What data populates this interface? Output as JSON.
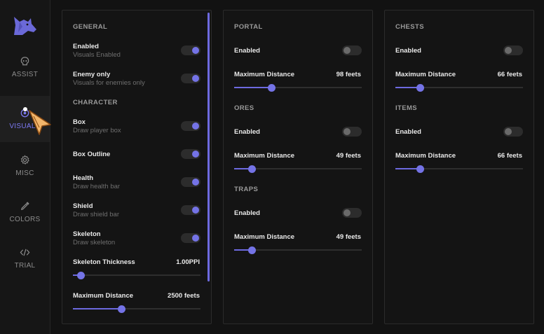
{
  "nav": [
    {
      "label": "",
      "icon": "wolf-logo-icon"
    },
    {
      "label": "ASSIST",
      "icon": "skull-icon"
    },
    {
      "label": "VISUALS",
      "icon": "eye-icon",
      "active": true
    },
    {
      "label": "MISC",
      "icon": "gear-icon"
    },
    {
      "label": "COLORS",
      "icon": "eyedropper-icon"
    },
    {
      "label": "TRIAL",
      "icon": "code-icon"
    }
  ],
  "colors": {
    "accent": "#7473e6",
    "background": "#121212",
    "panel": "#141414"
  },
  "left": {
    "general_title": "GENERAL",
    "character_title": "CHARACTER",
    "enabled": {
      "label": "Enabled",
      "sub": "Visuals Enabled",
      "on": true
    },
    "enemy_only": {
      "label": "Enemy only",
      "sub": "Visuals for enemies only",
      "on": true
    },
    "box": {
      "label": "Box",
      "sub": "Draw player box",
      "on": true
    },
    "box_outline": {
      "label": "Box Outline",
      "on": true
    },
    "health": {
      "label": "Health",
      "sub": "Draw health bar",
      "on": true
    },
    "shield": {
      "label": "Shield",
      "sub": "Draw shield bar",
      "on": true
    },
    "skeleton": {
      "label": "Skeleton",
      "sub": "Draw skeleton",
      "on": true
    },
    "skeleton_thickness": {
      "label": "Skeleton Thickness",
      "value": "1.00PPI",
      "fraction": 0.06
    },
    "max_distance": {
      "label": "Maximum Distance",
      "value": "2500 feets",
      "fraction": 0.38
    }
  },
  "middle": {
    "portal_title": "PORTAL",
    "portal_enabled": {
      "label": "Enabled",
      "on": false
    },
    "portal_distance": {
      "label": "Maximum Distance",
      "value": "98 feets",
      "fraction": 0.29
    },
    "ores_title": "ORES",
    "ores_enabled": {
      "label": "Enabled",
      "on": false
    },
    "ores_distance": {
      "label": "Maximum Distance",
      "value": "49 feets",
      "fraction": 0.14
    },
    "traps_title": "TRAPS",
    "traps_enabled": {
      "label": "Enabled",
      "on": false
    },
    "traps_distance": {
      "label": "Maximum Distance",
      "value": "49 feets",
      "fraction": 0.14
    }
  },
  "right": {
    "chests_title": "CHESTS",
    "chests_enabled": {
      "label": "Enabled",
      "on": false
    },
    "chests_distance": {
      "label": "Maximum Distance",
      "value": "66 feets",
      "fraction": 0.19
    },
    "items_title": "ITEMS",
    "items_enabled": {
      "label": "Enabled",
      "on": false
    },
    "items_distance": {
      "label": "Maximum Distance",
      "value": "66 feets",
      "fraction": 0.19
    }
  }
}
